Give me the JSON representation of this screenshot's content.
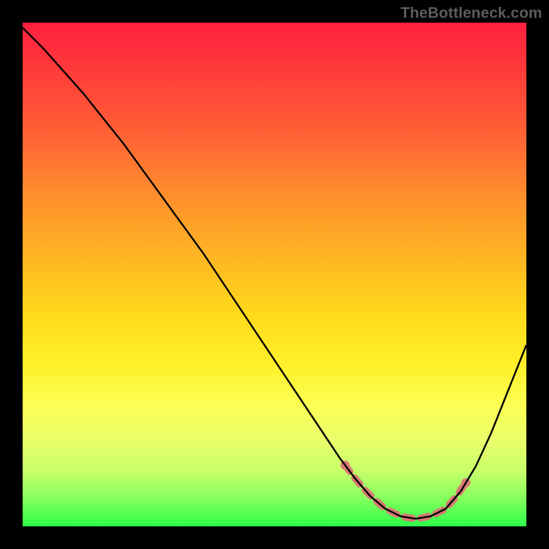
{
  "watermark": "TheBottleneck.com",
  "chart_data": {
    "type": "line",
    "title": "",
    "xlabel": "",
    "ylabel": "",
    "xlim": [
      0,
      100
    ],
    "ylim": [
      0,
      100
    ],
    "series": [
      {
        "name": "bottleneck-curve",
        "x": [
          0,
          4,
          8,
          12,
          16,
          20,
          24,
          28,
          32,
          36,
          40,
          44,
          48,
          52,
          56,
          60,
          63,
          66,
          69,
          72,
          75,
          78,
          81,
          84,
          87,
          90,
          93,
          96,
          100
        ],
        "y": [
          99,
          95,
          90.5,
          86,
          81,
          76,
          70.5,
          65,
          59.5,
          54,
          48,
          42,
          36,
          30,
          24,
          18,
          13.5,
          9.5,
          6,
          3.5,
          2,
          1.5,
          2,
          3.5,
          7,
          12,
          18.5,
          26,
          36
        ]
      }
    ],
    "annotations": [
      {
        "name": "valley-marker",
        "points_x": [
          64,
          66,
          68,
          70,
          72,
          74,
          76,
          78,
          80,
          82,
          84,
          86,
          88
        ],
        "points_y_band": 4.8
      }
    ],
    "colors": {
      "curve": "#000000",
      "marker": "#d87a74",
      "background_top": "#ff1f3f",
      "background_bottom": "#2dff4a",
      "frame": "#000000"
    }
  }
}
